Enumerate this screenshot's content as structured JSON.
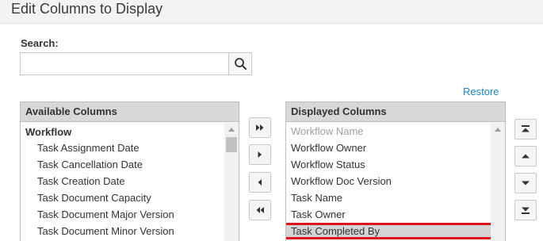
{
  "header": {
    "title": "Edit Columns to Display"
  },
  "search": {
    "label": "Search:",
    "value": "",
    "placeholder": "",
    "button_icon": "search-icon"
  },
  "restore_link": "Restore",
  "available": {
    "header": "Available Columns",
    "group": "Workflow",
    "items": [
      "Task Assignment Date",
      "Task Cancellation Date",
      "Task Creation Date",
      "Task Document Capacity",
      "Task Document Major Version",
      "Task Document Minor Version"
    ]
  },
  "displayed": {
    "header": "Displayed Columns",
    "items": [
      {
        "label": "Workflow Name",
        "state": "disabled"
      },
      {
        "label": "Workflow Owner",
        "state": "normal"
      },
      {
        "label": "Workflow Status",
        "state": "normal"
      },
      {
        "label": "Workflow Doc Version",
        "state": "normal"
      },
      {
        "label": "Task Name",
        "state": "normal"
      },
      {
        "label": "Task Owner",
        "state": "normal"
      },
      {
        "label": "Task Completed By",
        "state": "selected"
      }
    ]
  },
  "transfer_buttons": [
    "add-all-icon",
    "add-icon",
    "remove-icon",
    "remove-all-icon"
  ],
  "order_buttons": [
    "move-to-top-icon",
    "move-up-icon",
    "move-down-icon",
    "move-to-bottom-icon"
  ],
  "colors": {
    "accent_link": "#1a87c9",
    "selection_outline": "#e0141e",
    "header_bg": "#d8d8d8"
  }
}
